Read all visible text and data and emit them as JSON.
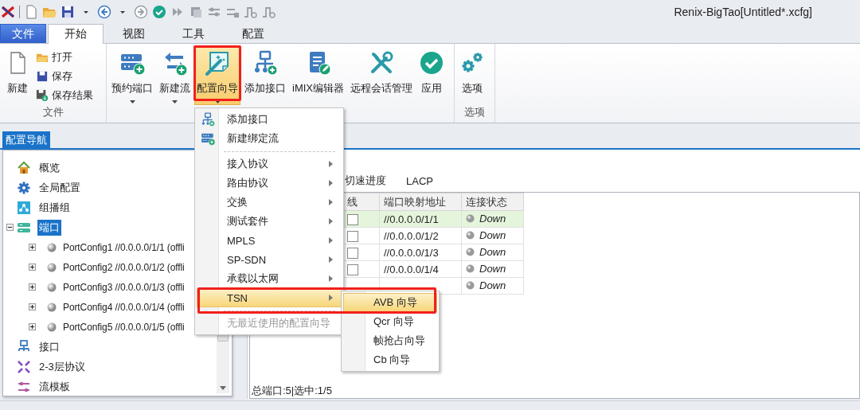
{
  "window": {
    "title": "Renix-BigTao[Untitled*.xcfg]"
  },
  "ribbon_tabs": [
    {
      "label": "文件",
      "kind": "file",
      "selected": false
    },
    {
      "label": "开始",
      "kind": "normal",
      "selected": true
    },
    {
      "label": "视图",
      "kind": "normal",
      "selected": false
    },
    {
      "label": "工具",
      "kind": "normal",
      "selected": false
    },
    {
      "label": "配置",
      "kind": "normal",
      "selected": false
    }
  ],
  "ribbon": {
    "file_group": {
      "new_button": "新建",
      "small_buttons": [
        "打开",
        "保存",
        "保存结果"
      ],
      "label": "文件"
    },
    "buttons": [
      {
        "label": "预约端口",
        "dropdown": true,
        "pressed": false,
        "annotated": false
      },
      {
        "label": "新建流",
        "dropdown": true,
        "pressed": false,
        "annotated": false
      },
      {
        "label": "配置向导",
        "dropdown": true,
        "pressed": true,
        "annotated": true
      },
      {
        "label": "添加接口",
        "dropdown": false,
        "pressed": false,
        "annotated": false
      },
      {
        "label": "iMIX编辑器",
        "dropdown": false,
        "pressed": false,
        "annotated": false
      },
      {
        "label": "远程会话管理",
        "dropdown": false,
        "pressed": false,
        "annotated": false
      },
      {
        "label": "应用",
        "dropdown": false,
        "pressed": false,
        "annotated": false
      }
    ],
    "options_group": {
      "button": "选项",
      "label": "选项"
    }
  },
  "nav": {
    "title": "配置导航",
    "items": [
      {
        "label": "概览",
        "selected": false
      },
      {
        "label": "全局配置",
        "selected": false
      },
      {
        "label": "组播组",
        "selected": false
      },
      {
        "label": "端口",
        "selected": true,
        "expanded": true,
        "children": [
          {
            "label": "PortConfig1 //0.0.0.0/1/1 (offli",
            "expanded": false
          },
          {
            "label": "PortConfig2 //0.0.0.0/1/2 (offli",
            "expanded": false
          },
          {
            "label": "PortConfig3 //0.0.0.0/1/3 (offli",
            "expanded": false
          },
          {
            "label": "PortConfig4 //0.0.0.0/1/4 (offli",
            "expanded": false
          },
          {
            "label": "PortConfig5 //0.0.0.0/1/5 (offli",
            "expanded": false
          }
        ]
      },
      {
        "label": "接口",
        "selected": false
      },
      {
        "label": "2-3层协议",
        "selected": false
      },
      {
        "label": "流模板",
        "selected": false
      }
    ]
  },
  "tabs": [
    {
      "label": "切速进度"
    },
    {
      "label": "LACP"
    }
  ],
  "table": {
    "columns": [
      "线",
      "端口映射地址",
      "连接状态"
    ],
    "rows": [
      {
        "checked": false,
        "address": "//0.0.0.0/1/1",
        "status": "Down",
        "selected": true
      },
      {
        "checked": false,
        "address": "//0.0.0.0/1/2",
        "status": "Down",
        "selected": false
      },
      {
        "checked": false,
        "address": "//0.0.0.0/1/3",
        "status": "Down",
        "selected": false
      },
      {
        "checked": false,
        "address": "//0.0.0.0/1/4",
        "status": "Down",
        "selected": false
      },
      {
        "status": "Down",
        "selected": false
      }
    ]
  },
  "status_bar": "总端口:5|选中:1/5",
  "menu": {
    "items": [
      {
        "kind": "command",
        "label": "添加接口",
        "selected": false,
        "disabled": false
      },
      {
        "kind": "command",
        "label": "新建绑定流",
        "selected": false,
        "disabled": false
      },
      {
        "kind": "separator"
      },
      {
        "kind": "submenu",
        "label": "接入协议",
        "selected": false,
        "disabled": false
      },
      {
        "kind": "submenu",
        "label": "路由协议",
        "selected": false,
        "disabled": false
      },
      {
        "kind": "submenu",
        "label": "交换",
        "selected": false,
        "disabled": false
      },
      {
        "kind": "submenu",
        "label": "测试套件",
        "selected": false,
        "disabled": false
      },
      {
        "kind": "submenu",
        "label": "MPLS",
        "selected": false,
        "disabled": false
      },
      {
        "kind": "submenu",
        "label": "SP-SDN",
        "selected": false,
        "disabled": false
      },
      {
        "kind": "submenu",
        "label": "承载以太网",
        "selected": false,
        "disabled": false
      },
      {
        "kind": "submenu",
        "label": "TSN",
        "selected": true,
        "disabled": false,
        "annotated": true
      },
      {
        "kind": "separator"
      },
      {
        "kind": "command",
        "label": "无最近使用的配置向导",
        "selected": false,
        "disabled": true
      }
    ]
  },
  "submenu": {
    "items": [
      {
        "label": "AVB 向导",
        "selected": true
      },
      {
        "label": "Qcr 向导",
        "selected": false
      },
      {
        "label": "帧抢占向导",
        "selected": false
      },
      {
        "label": "Cb 向导",
        "selected": false
      }
    ]
  }
}
